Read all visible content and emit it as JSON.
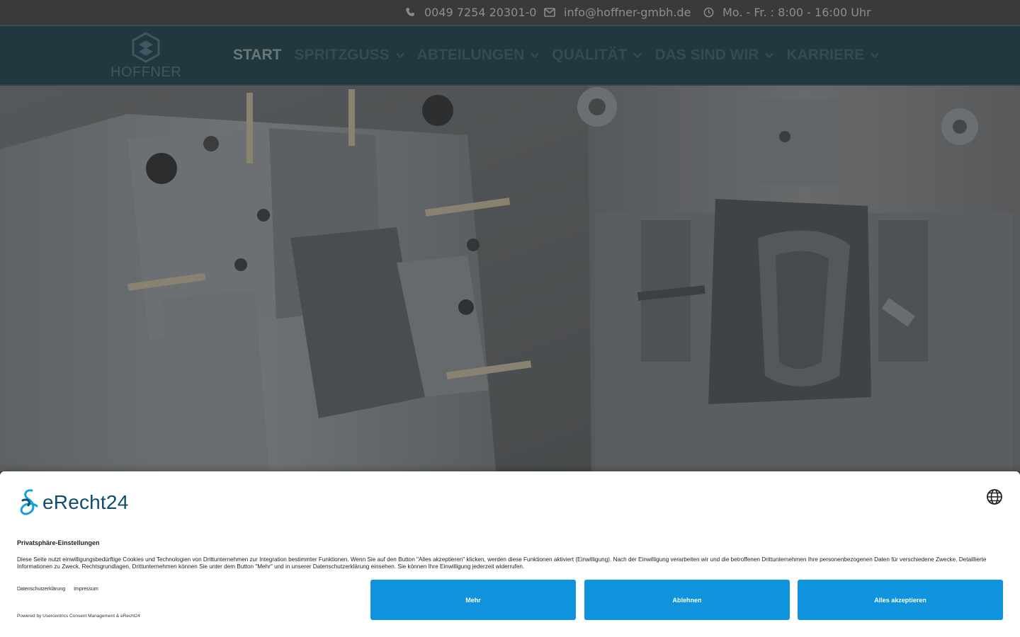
{
  "topbar": {
    "phone": {
      "icon": "phone-icon",
      "text": "0049 7254 20301-0"
    },
    "email": {
      "icon": "envelope-icon",
      "text": "info@hoffner-gmbh.de"
    },
    "hours": {
      "icon": "clock-icon",
      "text": "Mo. - Fr. : 8:00 - 16:00 Uhr"
    }
  },
  "nav": {
    "logo_text": "HOFFNER",
    "items": [
      {
        "label": "START",
        "active": true,
        "dropdown": false
      },
      {
        "label": "SPRITZGUSS",
        "active": false,
        "dropdown": true
      },
      {
        "label": "ABTEILUNGEN",
        "active": false,
        "dropdown": true
      },
      {
        "label": "QUALITÄT",
        "active": false,
        "dropdown": true
      },
      {
        "label": "DAS SIND WIR",
        "active": false,
        "dropdown": true
      },
      {
        "label": "KARRIERE",
        "active": false,
        "dropdown": true
      }
    ]
  },
  "hero": {
    "image": "injection-mold-photo"
  },
  "consent": {
    "brand": "eRecht24",
    "title": "Privatsphäre-Einstellungen",
    "body": "Diese Seite nutzt einwilligungsbedürftige Cookies und Technologien von Drittunternehmen zur Integration bestimmter Funktionen. Wenn Sie auf den Button \"Alles akzeptieren\" klicken, werden diese Funktionen aktiviert (Einwilligung). Nach der Einwilligung verarbeiten wir und die betroffenen Drittunternehmen Ihre personenbezogenen Daten für verschiedene Zwecke. Detaillierte Informationen zu Zweck, Rechtsgrundlagen, Drittunternehmen können Sie unter dem Button \"Mehr\" und in unserer Datenschutzerklärung einsehen. Sie können Ihre Einwilligung jederzeit widerrufen.",
    "links": {
      "privacy": "Datenschutzerklärung",
      "imprint": "Impressum"
    },
    "powered": "Powered by Usercentrics Consent Management & eRecht24",
    "buttons": {
      "more": "Mehr",
      "deny": "Ablehnen",
      "accept": "Alles akzeptieren"
    },
    "button_color": "#0f93dc"
  },
  "colors": {
    "topbar": "#3a3a3a",
    "nav": "#21383e",
    "brand": "#0f4d6b"
  }
}
